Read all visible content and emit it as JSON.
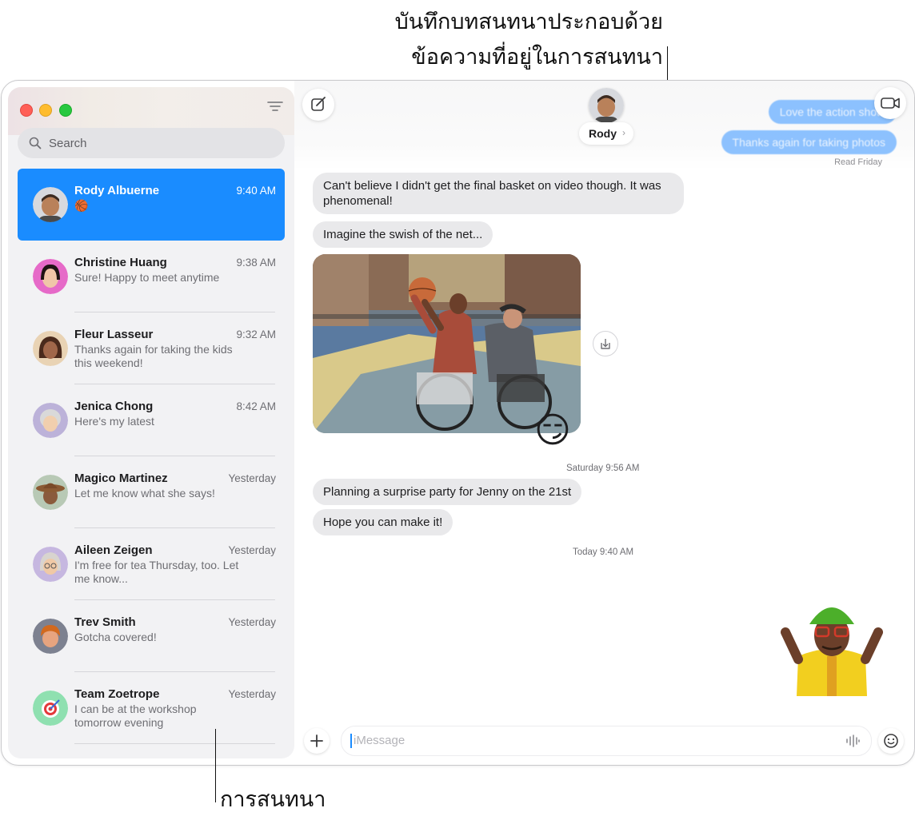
{
  "callouts": {
    "top_line1": "บันทึกบทสนทนาประกอบด้วย",
    "top_line2": "ข้อความที่อยู่ในการสนทนา",
    "bottom": "การสนทนา"
  },
  "sidebar": {
    "search_placeholder": "Search",
    "conversations": [
      {
        "name": "Rody Albuerne",
        "time": "9:40 AM",
        "preview": "🏀",
        "selected": true
      },
      {
        "name": "Christine Huang",
        "time": "9:38 AM",
        "preview": "Sure! Happy to meet anytime"
      },
      {
        "name": "Fleur Lasseur",
        "time": "9:32 AM",
        "preview": "Thanks again for taking the kids this weekend!"
      },
      {
        "name": "Jenica Chong",
        "time": "8:42 AM",
        "preview": "Here's my latest"
      },
      {
        "name": "Magico Martinez",
        "time": "Yesterday",
        "preview": "Let me know what she says!"
      },
      {
        "name": "Aileen Zeigen",
        "time": "Yesterday",
        "preview": "I'm free for tea Thursday, too. Let me know..."
      },
      {
        "name": "Trev Smith",
        "time": "Yesterday",
        "preview": "Gotcha covered!"
      },
      {
        "name": "Team Zoetrope",
        "time": "Yesterday",
        "preview": "I can be at the workshop tomorrow evening"
      }
    ]
  },
  "header": {
    "contact_name": "Rody",
    "chevron": "›"
  },
  "messages": {
    "sent_blurred_1": "Love the action shots",
    "sent_blurred_2": "Thanks again for taking photos",
    "read_status": "Read Friday",
    "m1": "Can't believe I didn't get the final basket on video though. It was phenomenal!",
    "m2": "Imagine the swish of the net...",
    "tapback": "😏",
    "ts1": "Saturday 9:56 AM",
    "m3": "Planning a surprise party for Jenny on the 21st",
    "m4": "Hope you can make it!",
    "ts2": "Today 9:40 AM"
  },
  "composer": {
    "placeholder": "iMessage"
  },
  "colors": {
    "accent": "#1a8cff",
    "received_bubble": "#e9e9eb",
    "sidebar_bg": "#f2f2f4"
  }
}
